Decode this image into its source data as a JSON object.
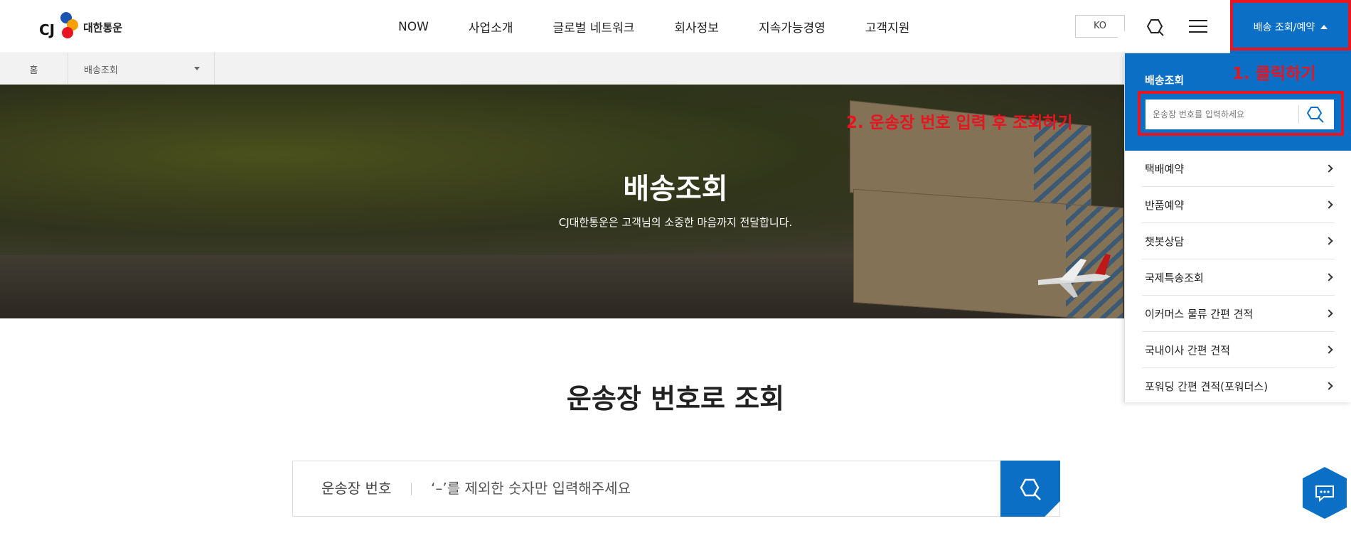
{
  "header": {
    "logo_text": "대한통운",
    "nav": [
      "NOW",
      "사업소개",
      "글로벌 네트워크",
      "회사정보",
      "지속가능경영",
      "고객지원"
    ],
    "lang": "KO",
    "delivery_button": "배송 조회/예약"
  },
  "breadcrumb": {
    "home": "홈",
    "current": "배송조회"
  },
  "hero": {
    "title": "배송조회",
    "subtitle": "CJ대한통운은 고객님의 소중한 마음까지 전달합니다."
  },
  "main": {
    "section_title": "운송장 번호로 조회",
    "search_label": "운송장 번호",
    "search_placeholder": "‘–’를 제외한 숫자만 입력해주세요"
  },
  "dropdown": {
    "title": "배송조회",
    "placeholder": "운송장 번호를 입력하세요",
    "items": [
      "택배예약",
      "반품예약",
      "챗봇상담",
      "국제특송조회",
      "이커머스 물류 간편 견적",
      "국내이사 간편 견적",
      "포워딩 간편 견적(포워더스)"
    ]
  },
  "annotations": {
    "step1": "1. 클릭하기",
    "step2": "2. 운송장 번호 입력 후 조회하기"
  },
  "colors": {
    "brand_blue": "#0b6fc5",
    "annotation_red": "#e8141f"
  }
}
